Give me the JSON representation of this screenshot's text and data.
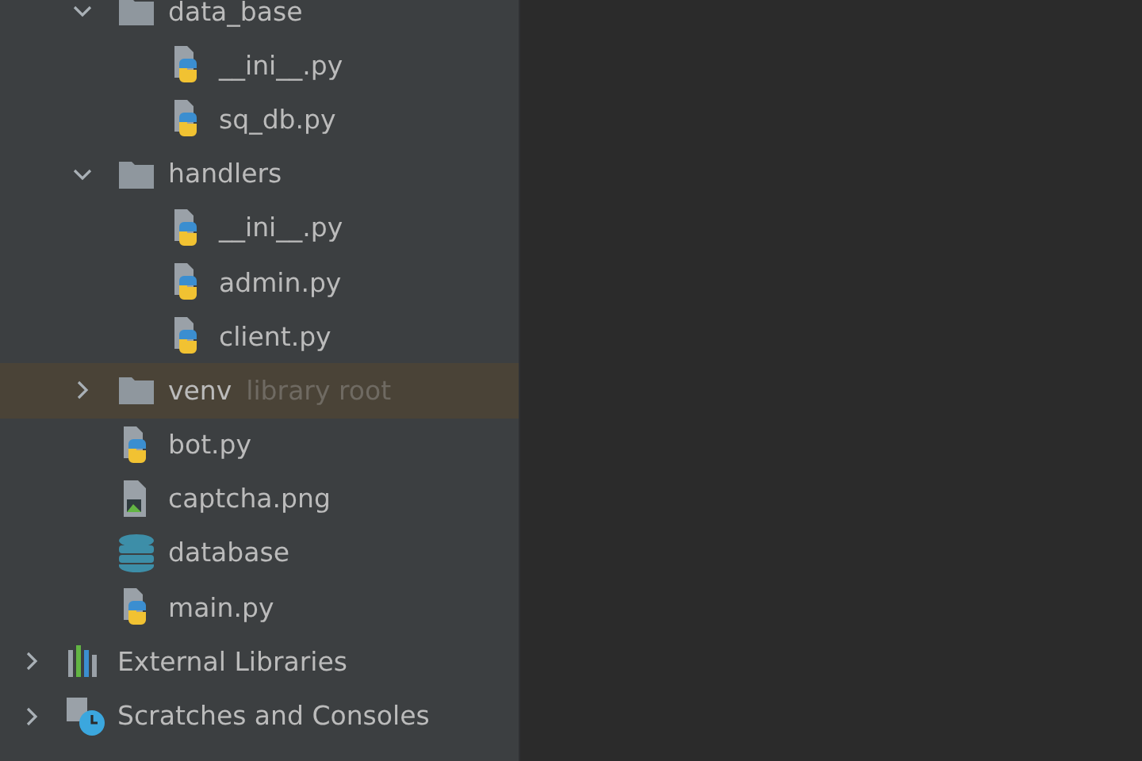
{
  "project_items": [
    {
      "label": "data_base",
      "kind": "folder",
      "expanded": true,
      "children": [
        {
          "label": "__ini__.py",
          "kind": "python"
        },
        {
          "label": "sq_db.py",
          "kind": "python"
        }
      ]
    },
    {
      "label": "handlers",
      "kind": "folder",
      "expanded": true,
      "children": [
        {
          "label": "__ini__.py",
          "kind": "python"
        },
        {
          "label": "admin.py",
          "kind": "python"
        },
        {
          "label": "client.py",
          "kind": "python"
        }
      ]
    },
    {
      "label": "venv",
      "kind": "folder",
      "expanded": false,
      "highlighted": true,
      "note": "library root"
    },
    {
      "label": "bot.py",
      "kind": "python"
    },
    {
      "label": "captcha.png",
      "kind": "image"
    },
    {
      "label": "database",
      "kind": "database"
    },
    {
      "label": "main.py",
      "kind": "python"
    }
  ],
  "root_items": [
    {
      "label": "External Libraries",
      "kind": "libraries",
      "expanded": false
    },
    {
      "label": "Scratches and Consoles",
      "kind": "scratches",
      "expanded": false
    }
  ]
}
